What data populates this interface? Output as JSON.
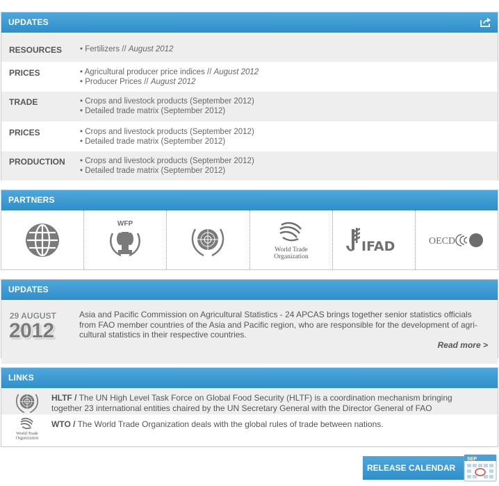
{
  "updates": {
    "title": "UPDATES",
    "rows": [
      {
        "category": "RESOURCES",
        "items": [
          {
            "text": "Fertilizers // ",
            "italic": "August 2012"
          }
        ]
      },
      {
        "category": "PRICES",
        "items": [
          {
            "text": "Agricultural producer price indices // ",
            "italic": "August 2012"
          },
          {
            "text": "Producer Prices // ",
            "italic": "August 2012"
          }
        ]
      },
      {
        "category": "TRADE",
        "items": [
          {
            "text": "Crops and livestock products (September 2012)",
            "italic": ""
          },
          {
            "text": "Detailed trade matrix (September 2012)",
            "italic": ""
          }
        ]
      },
      {
        "category": "PRICES",
        "items": [
          {
            "text": "Crops and livestock products (September 2012)",
            "italic": ""
          },
          {
            "text": "Detailed trade matrix (September 2012)",
            "italic": ""
          }
        ]
      },
      {
        "category": "PRODUCTION",
        "items": [
          {
            "text": "Crops and livestock products (September 2012)",
            "italic": ""
          },
          {
            "text": "Detailed trade matrix (September 2012)",
            "italic": ""
          }
        ]
      }
    ]
  },
  "partners": {
    "title": "PARTNERS",
    "logos": {
      "wfp": "WFP",
      "wto_line1": "World Trade",
      "wto_line2": "Organization",
      "ifad": "IFAD",
      "oecd": "OECD"
    }
  },
  "news": {
    "title": "UPDATES",
    "day": "29 AUGUST",
    "year": "2012",
    "text": "Asia and Pacific Commission on Agricultural Statistics - 24 APCAS brings together senior statistics officials from FAO member countries of the Asia and Pacific region, who are responsible for the development of agri-cultural statistics in their respective countries.",
    "read_more": "Read more >"
  },
  "links": {
    "title": "LINKS",
    "items": [
      {
        "abbr": "HLTF /",
        "text": "The UN High Level Task Force on Global Food Security (HLTF) is a coordination mechanism bringing together 23 international entities chaired by the UN Secretary General with the Director General of FAO"
      },
      {
        "abbr": "WTO /",
        "text": "The World Trade Organization deals with the global rules of trade between nations.",
        "logo_line1": "World Trade",
        "logo_line2": "Organization"
      }
    ]
  },
  "release_calendar": {
    "label": "RELEASE CALENDAR",
    "month": "SEP"
  },
  "colors": {
    "header_blue": "#3a9bd4",
    "row_gray": "#eeeeee",
    "text": "#555555"
  }
}
